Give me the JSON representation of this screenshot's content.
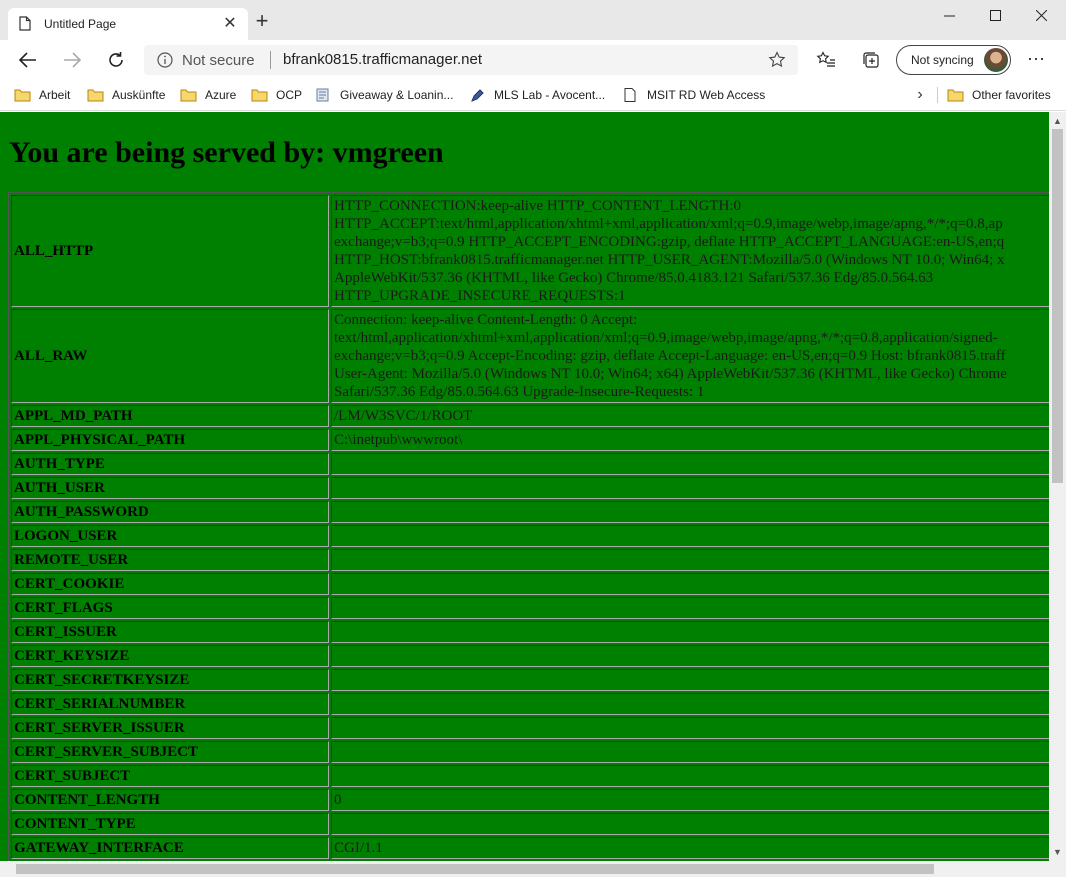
{
  "browser": {
    "tab_title": "Untitled Page",
    "new_tab_symbol": "+",
    "not_secure_label": "Not secure",
    "url": "bfrank0815.trafficmanager.net",
    "profile_label": "Not syncing",
    "more_symbol": "···"
  },
  "favorites": {
    "items": [
      {
        "label": "Arbeit",
        "icon": "folder-icon"
      },
      {
        "label": "Auskünfte",
        "icon": "folder-icon"
      },
      {
        "label": "Azure",
        "icon": "folder-icon"
      },
      {
        "label": "OCP",
        "icon": "folder-icon"
      },
      {
        "label": "Giveaway & Loanin...",
        "icon": "document-icon"
      },
      {
        "label": "MLS Lab - Avocent...",
        "icon": "pen-icon"
      },
      {
        "label": "MSIT RD Web Access",
        "icon": "page-icon"
      }
    ],
    "other": {
      "label": "Other favorites",
      "icon": "folder-icon"
    }
  },
  "page": {
    "heading": "You are being served by: vmgreen",
    "background": "#008000",
    "all_http_lines": [
      "HTTP_CONNECTION:keep-alive HTTP_CONTENT_LENGTH:0",
      "HTTP_ACCEPT:text/html,application/xhtml+xml,application/xml;q=0.9,image/webp,image/apng,*/*;q=0.8,ap",
      "exchange;v=b3;q=0.9 HTTP_ACCEPT_ENCODING:gzip, deflate HTTP_ACCEPT_LANGUAGE:en-US,en;q",
      "HTTP_HOST:bfrank0815.trafficmanager.net HTTP_USER_AGENT:Mozilla/5.0 (Windows NT 10.0; Win64; x",
      "AppleWebKit/537.36 (KHTML, like Gecko) Chrome/85.0.4183.121 Safari/537.36 Edg/85.0.564.63",
      "HTTP_UPGRADE_INSECURE_REQUESTS:1"
    ],
    "all_raw_lines": [
      "Connection: keep-alive Content-Length: 0 Accept:",
      "text/html,application/xhtml+xml,application/xml;q=0.9,image/webp,image/apng,*/*;q=0.8,application/signed-",
      "exchange;v=b3;q=0.9 Accept-Encoding: gzip, deflate Accept-Language: en-US,en;q=0.9 Host: bfrank0815.traff",
      "User-Agent: Mozilla/5.0 (Windows NT 10.0; Win64; x64) AppleWebKit/537.36 (KHTML, like Gecko) Chrome",
      "Safari/537.36 Edg/85.0.564.63 Upgrade-Insecure-Requests: 1"
    ],
    "rows": [
      {
        "key": "ALL_HTTP",
        "value": ""
      },
      {
        "key": "ALL_RAW",
        "value": ""
      },
      {
        "key": "APPL_MD_PATH",
        "value": "/LM/W3SVC/1/ROOT"
      },
      {
        "key": "APPL_PHYSICAL_PATH",
        "value": "C:\\inetpub\\wwwroot\\"
      },
      {
        "key": "AUTH_TYPE",
        "value": ""
      },
      {
        "key": "AUTH_USER",
        "value": ""
      },
      {
        "key": "AUTH_PASSWORD",
        "value": ""
      },
      {
        "key": "LOGON_USER",
        "value": ""
      },
      {
        "key": "REMOTE_USER",
        "value": ""
      },
      {
        "key": "CERT_COOKIE",
        "value": ""
      },
      {
        "key": "CERT_FLAGS",
        "value": ""
      },
      {
        "key": "CERT_ISSUER",
        "value": ""
      },
      {
        "key": "CERT_KEYSIZE",
        "value": ""
      },
      {
        "key": "CERT_SECRETKEYSIZE",
        "value": ""
      },
      {
        "key": "CERT_SERIALNUMBER",
        "value": ""
      },
      {
        "key": "CERT_SERVER_ISSUER",
        "value": ""
      },
      {
        "key": "CERT_SERVER_SUBJECT",
        "value": ""
      },
      {
        "key": "CERT_SUBJECT",
        "value": ""
      },
      {
        "key": "CONTENT_LENGTH",
        "value": "0"
      },
      {
        "key": "CONTENT_TYPE",
        "value": ""
      },
      {
        "key": "GATEWAY_INTERFACE",
        "value": "CGI/1.1"
      }
    ]
  }
}
